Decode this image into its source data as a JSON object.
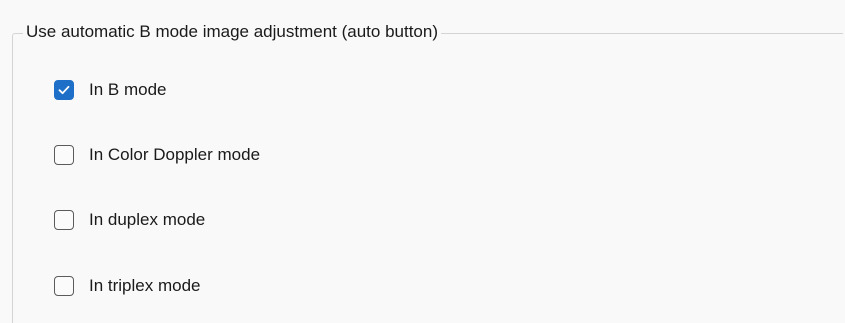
{
  "group": {
    "title": "Use automatic B mode image adjustment (auto button)"
  },
  "options": [
    {
      "label": "In B mode",
      "checked": true
    },
    {
      "label": "In Color Doppler mode",
      "checked": false
    },
    {
      "label": "In duplex mode",
      "checked": false
    },
    {
      "label": "In triplex mode",
      "checked": false
    }
  ],
  "colors": {
    "accent": "#1e6fc8",
    "checkmark": "#ffffff",
    "unchecked_border": "#5b5b5b",
    "background": "#f9f9f9"
  }
}
